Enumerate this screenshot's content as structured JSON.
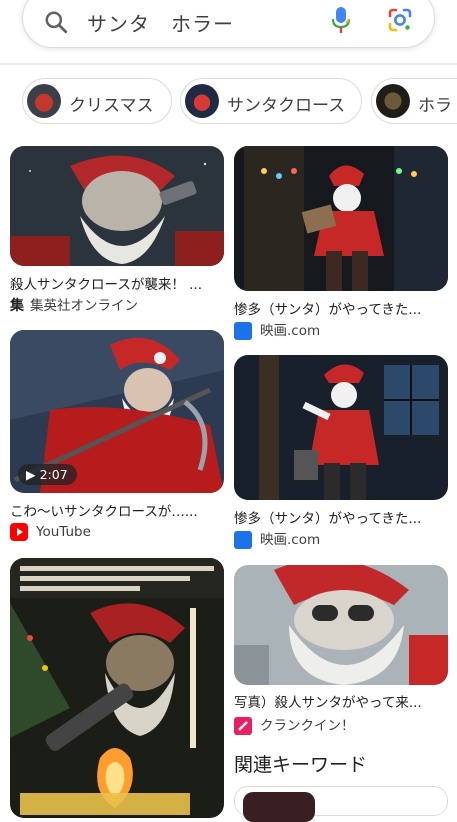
{
  "search": {
    "query": "サンタ　ホラー"
  },
  "chips": [
    {
      "label": "クリスマス"
    },
    {
      "label": "サンタクロース"
    },
    {
      "label": "ホラ"
    }
  ],
  "results": [
    {
      "title": "殺人サンタクロースが襲来！ ...",
      "source": "集英社オンライン",
      "source_icon": "shueisha-icon"
    },
    {
      "title": "惨多（サンタ）がやってきた...",
      "source": "映画.com",
      "source_icon": "eiga-com-icon"
    },
    {
      "title": "こわ〜いサンタクロースが…...",
      "source": "YouTube",
      "source_icon": "youtube-icon",
      "duration": "2:07"
    },
    {
      "title": "惨多（サンタ）がやってきた...",
      "source": "映画.com",
      "source_icon": "eiga-com-icon"
    },
    {
      "title": "写真）殺人サンタがやって来...",
      "source": "クランクイン！",
      "source_icon": "crank-in-icon"
    },
    {
      "title": "",
      "source": ""
    }
  ],
  "related": {
    "heading": "関連キーワード"
  },
  "colors": {
    "border": "#dadce0",
    "text": "#202124",
    "youtube_red": "#ff0000",
    "eiga_blue": "#1a73e8",
    "crankin_pink": "#e91e63"
  }
}
